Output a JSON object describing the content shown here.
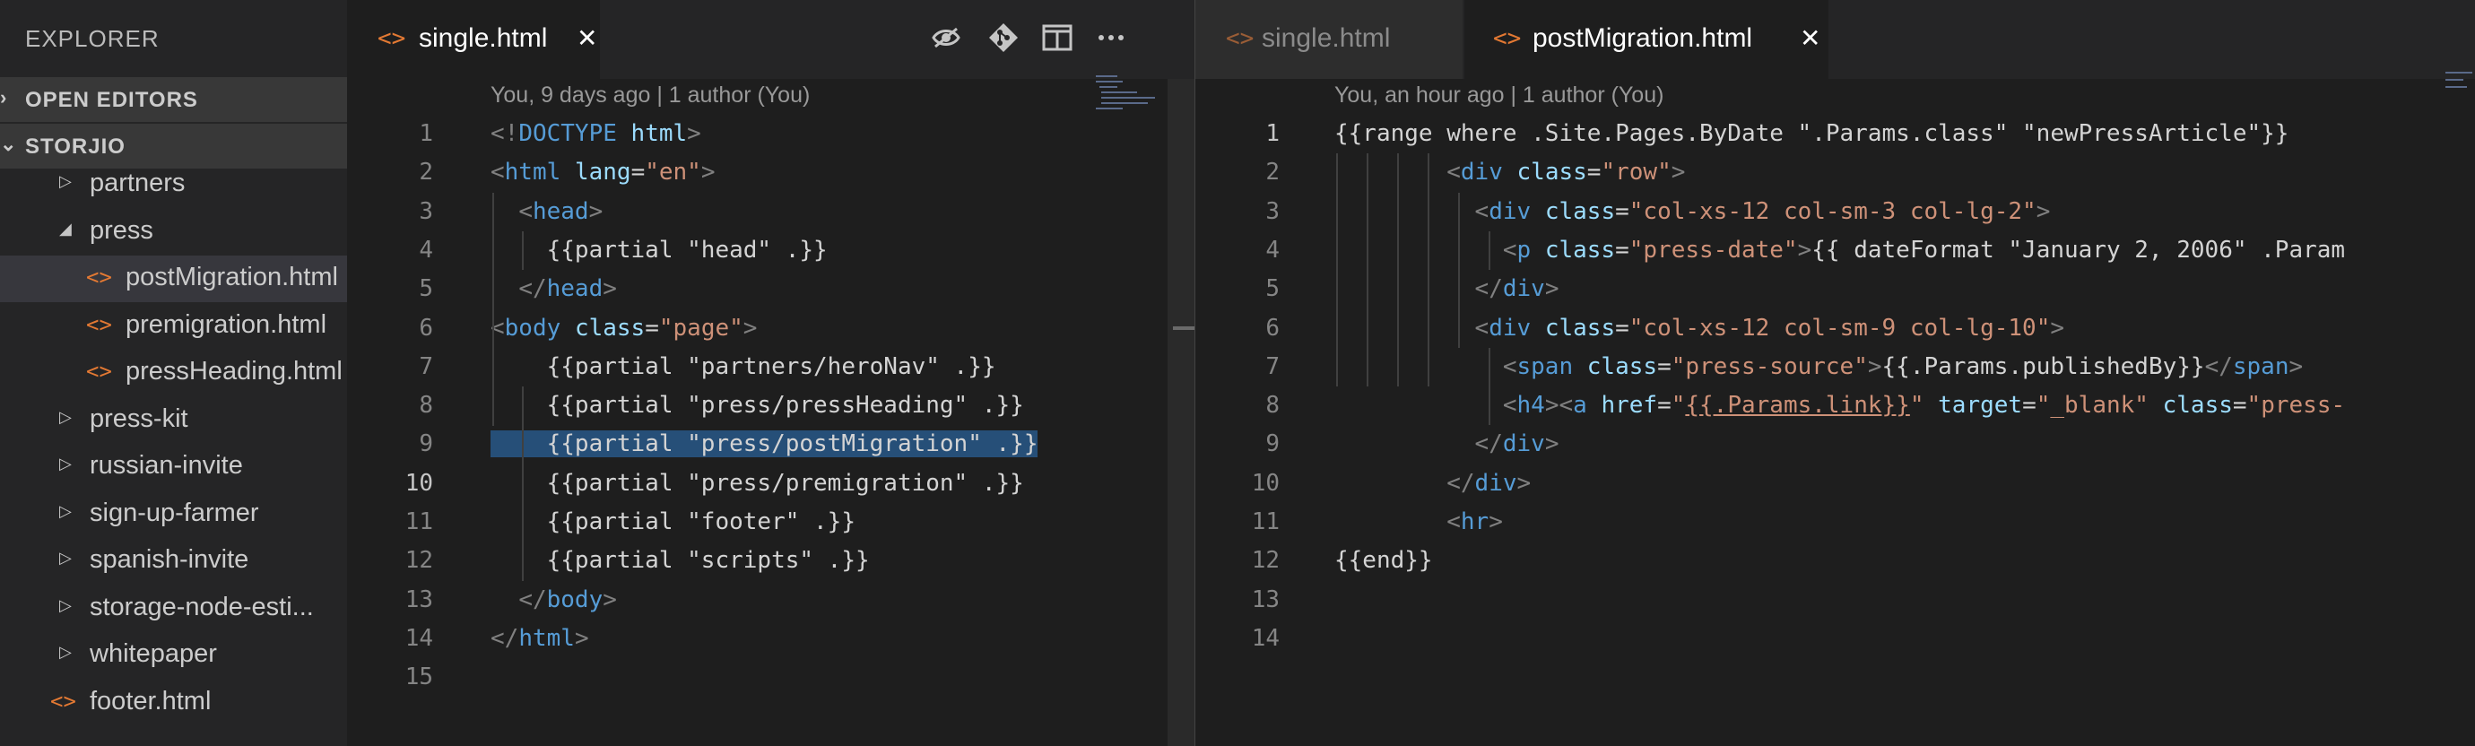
{
  "explorer": {
    "title": "EXPLORER",
    "sections": {
      "open_editors": "OPEN EDITORS",
      "project": "STORJIO"
    },
    "tree": [
      {
        "label": "partners",
        "type": "folder",
        "expanded": false,
        "depth": 1
      },
      {
        "label": "press",
        "type": "folder",
        "expanded": true,
        "depth": 1
      },
      {
        "label": "postMigration.html",
        "type": "file",
        "depth": 2,
        "selected": true
      },
      {
        "label": "premigration.html",
        "type": "file",
        "depth": 2
      },
      {
        "label": "pressHeading.html",
        "type": "file",
        "depth": 2
      },
      {
        "label": "press-kit",
        "type": "folder",
        "expanded": false,
        "depth": 1
      },
      {
        "label": "russian-invite",
        "type": "folder",
        "expanded": false,
        "depth": 1
      },
      {
        "label": "sign-up-farmer",
        "type": "folder",
        "expanded": false,
        "depth": 1
      },
      {
        "label": "spanish-invite",
        "type": "folder",
        "expanded": false,
        "depth": 1
      },
      {
        "label": "storage-node-esti...",
        "type": "folder",
        "expanded": false,
        "depth": 1
      },
      {
        "label": "whitepaper",
        "type": "folder",
        "expanded": false,
        "depth": 1
      },
      {
        "label": "footer.html",
        "type": "file",
        "depth": 1
      }
    ]
  },
  "left_editor": {
    "tab": {
      "label": "single.html",
      "close": "✕"
    },
    "blame": "You, 9 days ago | 1 author (You)",
    "current_line": 10,
    "highlight_line": 9,
    "lines": [
      [
        [
          "br",
          "<!"
        ],
        [
          "tag",
          "DOCTYPE"
        ],
        [
          "txt",
          " "
        ],
        [
          "attr",
          "html"
        ],
        [
          "br",
          ">"
        ]
      ],
      [
        [
          "br",
          "<"
        ],
        [
          "tag",
          "html"
        ],
        [
          "txt",
          " "
        ],
        [
          "attr",
          "lang"
        ],
        [
          "txt",
          "="
        ],
        [
          "str",
          "\"en\""
        ],
        [
          "br",
          ">"
        ]
      ],
      [
        [
          "txt",
          "  "
        ],
        [
          "br",
          "<"
        ],
        [
          "tag",
          "head"
        ],
        [
          "br",
          ">"
        ]
      ],
      [
        [
          "txt",
          "    {{partial \"head\" .}}"
        ]
      ],
      [
        [
          "txt",
          "  "
        ],
        [
          "br",
          "</"
        ],
        [
          "tag",
          "head"
        ],
        [
          "br",
          ">"
        ]
      ],
      [
        [
          "br",
          "<"
        ],
        [
          "tag",
          "body"
        ],
        [
          "txt",
          " "
        ],
        [
          "attr",
          "class"
        ],
        [
          "txt",
          "="
        ],
        [
          "str",
          "\"page\""
        ],
        [
          "br",
          ">"
        ]
      ],
      [
        [
          "txt",
          "    {{partial \"partners/heroNav\" .}}"
        ]
      ],
      [
        [
          "txt",
          "    {{partial \"press/pressHeading\" .}}"
        ]
      ],
      [
        [
          "txt",
          "    {{partial \"press/postMigration\" .}}"
        ]
      ],
      [
        [
          "txt",
          "    {{partial \"press/premigration\" .}}"
        ]
      ],
      [
        [
          "txt",
          "    {{partial \"footer\" .}}"
        ]
      ],
      [
        [
          "txt",
          "    {{partial \"scripts\" .}}"
        ]
      ],
      [
        [
          "txt",
          "  "
        ],
        [
          "br",
          "</"
        ],
        [
          "tag",
          "body"
        ],
        [
          "br",
          ">"
        ]
      ],
      [
        [
          "br",
          "</"
        ],
        [
          "tag",
          "html"
        ],
        [
          "br",
          ">"
        ]
      ],
      []
    ]
  },
  "right_editor": {
    "tabs": [
      {
        "label": "single.html",
        "active": false
      },
      {
        "label": "postMigration.html",
        "active": true,
        "close": "✕"
      }
    ],
    "blame": "You, an hour ago | 1 author (You)",
    "current_line": 1,
    "lines": [
      [
        [
          "txt",
          "{{range where .Site.Pages.ByDate \".Params.class\" \"newPressArticle\"}}"
        ]
      ],
      [
        [
          "txt",
          "        "
        ],
        [
          "br",
          "<"
        ],
        [
          "tag",
          "div"
        ],
        [
          "txt",
          " "
        ],
        [
          "attr",
          "class"
        ],
        [
          "txt",
          "="
        ],
        [
          "str",
          "\"row\""
        ],
        [
          "br",
          ">"
        ]
      ],
      [
        [
          "txt",
          "          "
        ],
        [
          "br",
          "<"
        ],
        [
          "tag",
          "div"
        ],
        [
          "txt",
          " "
        ],
        [
          "attr",
          "class"
        ],
        [
          "txt",
          "="
        ],
        [
          "str",
          "\"col-xs-12 col-sm-3 col-lg-2\""
        ],
        [
          "br",
          ">"
        ]
      ],
      [
        [
          "txt",
          "            "
        ],
        [
          "br",
          "<"
        ],
        [
          "tag",
          "p"
        ],
        [
          "txt",
          " "
        ],
        [
          "attr",
          "class"
        ],
        [
          "txt",
          "="
        ],
        [
          "str",
          "\"press-date\""
        ],
        [
          "br",
          ">"
        ],
        [
          "txt",
          "{{ dateFormat \"January 2, 2006\" .Param"
        ]
      ],
      [
        [
          "txt",
          "          "
        ],
        [
          "br",
          "</"
        ],
        [
          "tag",
          "div"
        ],
        [
          "br",
          ">"
        ]
      ],
      [
        [
          "txt",
          "          "
        ],
        [
          "br",
          "<"
        ],
        [
          "tag",
          "div"
        ],
        [
          "txt",
          " "
        ],
        [
          "attr",
          "class"
        ],
        [
          "txt",
          "="
        ],
        [
          "str",
          "\"col-xs-12 col-sm-9 col-lg-10\""
        ],
        [
          "br",
          ">"
        ]
      ],
      [
        [
          "txt",
          "            "
        ],
        [
          "br",
          "<"
        ],
        [
          "tag",
          "span"
        ],
        [
          "txt",
          " "
        ],
        [
          "attr",
          "class"
        ],
        [
          "txt",
          "="
        ],
        [
          "str",
          "\"press-source\""
        ],
        [
          "br",
          ">"
        ],
        [
          "txt",
          "{{.Params.publishedBy}}"
        ],
        [
          "br",
          "</"
        ],
        [
          "tag",
          "span"
        ],
        [
          "br",
          ">"
        ]
      ],
      [
        [
          "txt",
          "            "
        ],
        [
          "br",
          "<"
        ],
        [
          "tag",
          "h4"
        ],
        [
          "br",
          "><"
        ],
        [
          "tag",
          "a"
        ],
        [
          "txt",
          " "
        ],
        [
          "attr",
          "href"
        ],
        [
          "txt",
          "="
        ],
        [
          "str",
          "\""
        ],
        [
          "link",
          "{{.Params.link}}"
        ],
        [
          "str",
          "\""
        ],
        [
          "txt",
          " "
        ],
        [
          "attr",
          "target"
        ],
        [
          "txt",
          "="
        ],
        [
          "str",
          "\"_blank\""
        ],
        [
          "txt",
          " "
        ],
        [
          "attr",
          "class"
        ],
        [
          "txt",
          "="
        ],
        [
          "str",
          "\"press-"
        ]
      ],
      [
        [
          "txt",
          "          "
        ],
        [
          "br",
          "</"
        ],
        [
          "tag",
          "div"
        ],
        [
          "br",
          ">"
        ]
      ],
      [
        [
          "txt",
          "        "
        ],
        [
          "br",
          "</"
        ],
        [
          "tag",
          "div"
        ],
        [
          "br",
          ">"
        ]
      ],
      [
        [
          "txt",
          "        "
        ],
        [
          "br",
          "<"
        ],
        [
          "tag",
          "hr"
        ],
        [
          "br",
          ">"
        ]
      ],
      [
        [
          "txt",
          "{{end}}"
        ]
      ],
      [],
      []
    ]
  },
  "toolbar": {
    "icons": [
      "open-changes-icon",
      "git-compare-icon",
      "split-editor-icon",
      "more-actions-icon"
    ]
  }
}
